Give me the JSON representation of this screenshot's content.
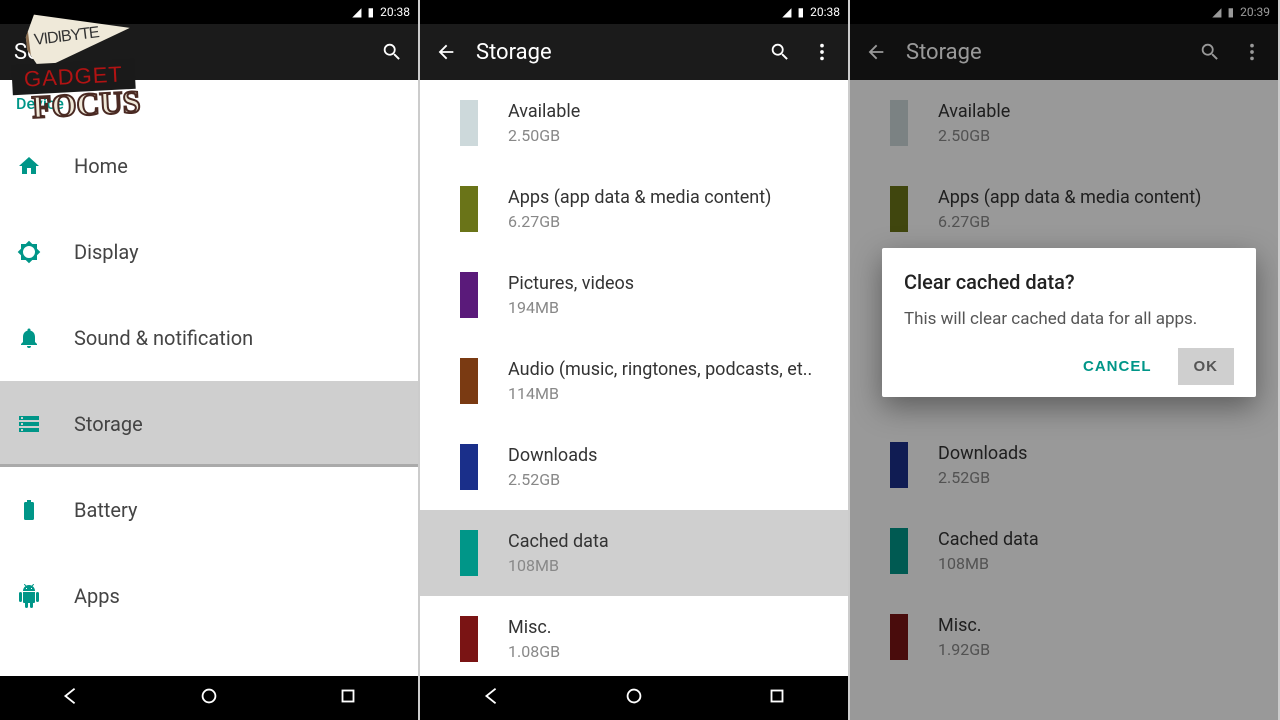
{
  "status_time": "20:38",
  "status_time_3": "20:39",
  "panel1": {
    "title": "Set",
    "subheader": "Device",
    "items": [
      {
        "label": "Home"
      },
      {
        "label": "Display"
      },
      {
        "label": "Sound & notification"
      },
      {
        "label": "Storage"
      },
      {
        "label": "Battery"
      },
      {
        "label": "Apps"
      }
    ]
  },
  "panel2": {
    "title": "Storage",
    "items": [
      {
        "label": "Available",
        "value": "2.50GB",
        "color": "#cdd9db"
      },
      {
        "label": "Apps (app data & media content)",
        "value": "6.27GB",
        "color": "#6a7418"
      },
      {
        "label": "Pictures, videos",
        "value": "194MB",
        "color": "#5a1a7a"
      },
      {
        "label": "Audio (music, ringtones, podcasts, et..",
        "value": "114MB",
        "color": "#7a3a12"
      },
      {
        "label": "Downloads",
        "value": "2.52GB",
        "color": "#1a2f8a"
      },
      {
        "label": "Cached data",
        "value": "108MB",
        "color": "#009688"
      },
      {
        "label": "Misc.",
        "value": "1.08GB",
        "color": "#7a1414"
      }
    ]
  },
  "panel3": {
    "title": "Storage",
    "items": [
      {
        "label": "Available",
        "value": "2.50GB",
        "color": "#cdd9db"
      },
      {
        "label": "Apps (app data & media content)",
        "value": "6.27GB",
        "color": "#6a7418"
      },
      {
        "label": "Downloads",
        "value": "2.52GB",
        "color": "#1a2f8a"
      },
      {
        "label": "Cached data",
        "value": "108MB",
        "color": "#009688"
      },
      {
        "label": "Misc.",
        "value": "1.92GB",
        "color": "#7a1414"
      }
    ],
    "dialog": {
      "title": "Clear cached data?",
      "message": "This will clear cached data for all apps.",
      "cancel": "CANCEL",
      "ok": "OK"
    }
  },
  "logo": {
    "line1": "VIDIBYTE",
    "line2": "GADGET",
    "line3": "FOCUS"
  }
}
